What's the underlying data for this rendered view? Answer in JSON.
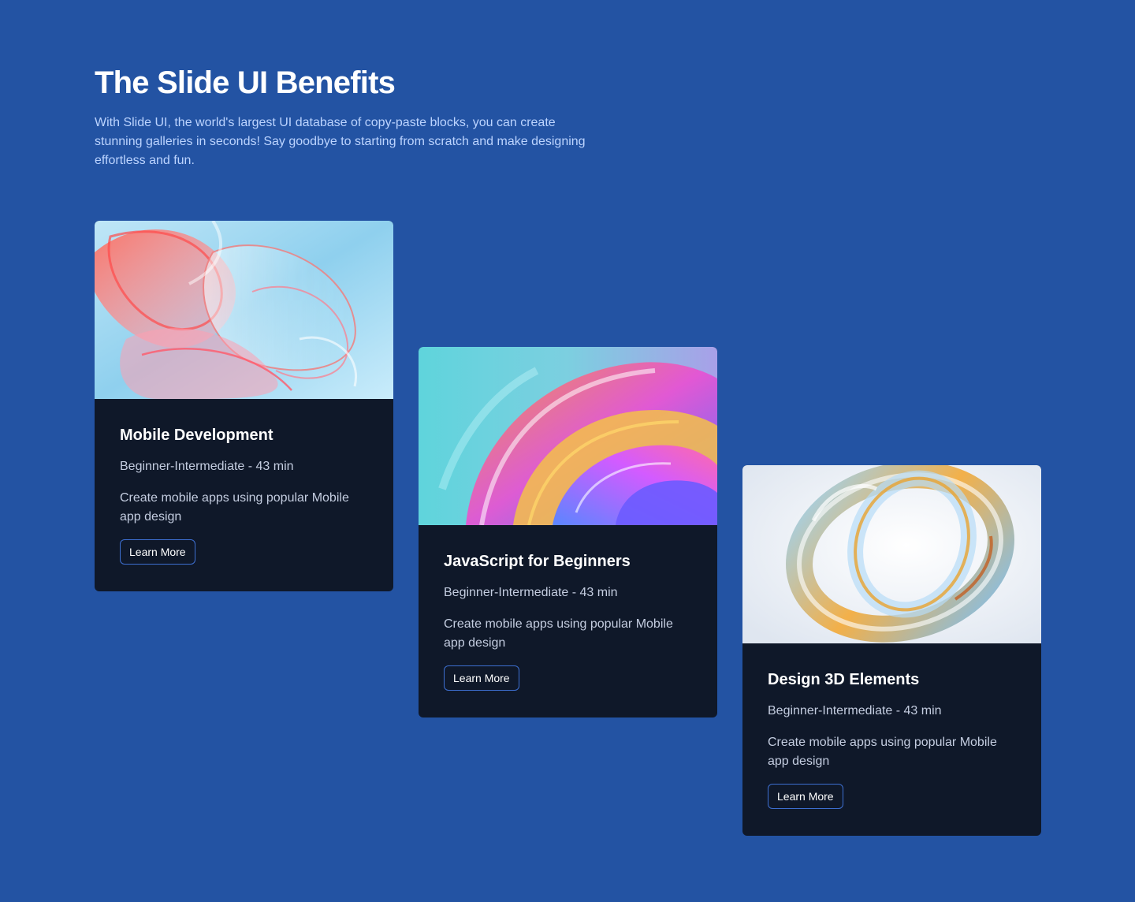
{
  "header": {
    "title": "The Slide UI Benefits",
    "subtitle": "With Slide UI, the world's largest UI database of copy-paste blocks, you can create stunning galleries in seconds! Say goodbye to starting from scratch and make designing effortless and fun."
  },
  "cards": [
    {
      "title": "Mobile Development",
      "meta": "Beginner-Intermediate - 43 min",
      "description": "Create mobile apps using popular Mobile app design",
      "button_label": "Learn More",
      "image": "abstract-glass-petals-image"
    },
    {
      "title": "JavaScript for Beginners",
      "meta": "Beginner-Intermediate - 43 min",
      "description": "Create mobile apps using popular Mobile app design",
      "button_label": "Learn More",
      "image": "abstract-iridescent-swirl-image"
    },
    {
      "title": "Design 3D Elements",
      "meta": "Beginner-Intermediate - 43 min",
      "description": "Create mobile apps using popular Mobile app design",
      "button_label": "Learn More",
      "image": "abstract-glass-ring-image"
    }
  ],
  "colors": {
    "background": "#2353a3",
    "card_background": "#0f1829",
    "subtitle_text": "#bcd4ff",
    "button_border": "#3d6fd1"
  }
}
